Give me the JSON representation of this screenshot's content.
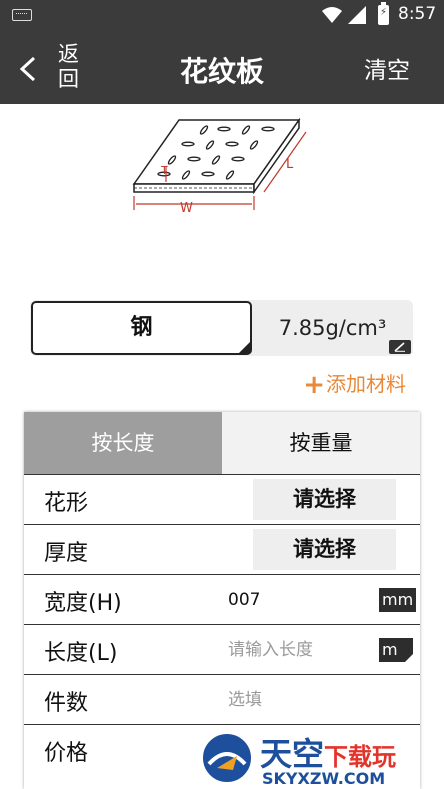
{
  "status_bar": {
    "time": "8:57",
    "icons": [
      "keyboard-icon",
      "wifi-icon",
      "signal-icon",
      "battery-charging-icon"
    ]
  },
  "app_bar": {
    "back_label": "返回",
    "title": "花纹板",
    "clear_label": "清空"
  },
  "diagram": {
    "labels": [
      "T",
      "L",
      "W"
    ],
    "accent_color": "#c0392b"
  },
  "material": {
    "name": "钢",
    "density": "7.85g/cm³"
  },
  "add_material_label": "添加材料",
  "add_material_color": "#e8893a",
  "tabs": [
    {
      "label": "按长度",
      "active": true
    },
    {
      "label": "按重量",
      "active": false
    }
  ],
  "form": {
    "pattern": {
      "label": "花形",
      "value": "请选择"
    },
    "thickness": {
      "label": "厚度",
      "value": "请选择"
    },
    "width": {
      "label": "宽度(H)",
      "value": "007",
      "unit": "mm"
    },
    "length": {
      "label": "长度(L)",
      "placeholder": "请输入长度",
      "unit": "m"
    },
    "count": {
      "label": "件数",
      "placeholder": "选填"
    },
    "price": {
      "label": "价格"
    }
  },
  "watermark": {
    "title_main": "天空",
    "title_sub": "下载玩",
    "url": "SKYXZW.COM"
  }
}
